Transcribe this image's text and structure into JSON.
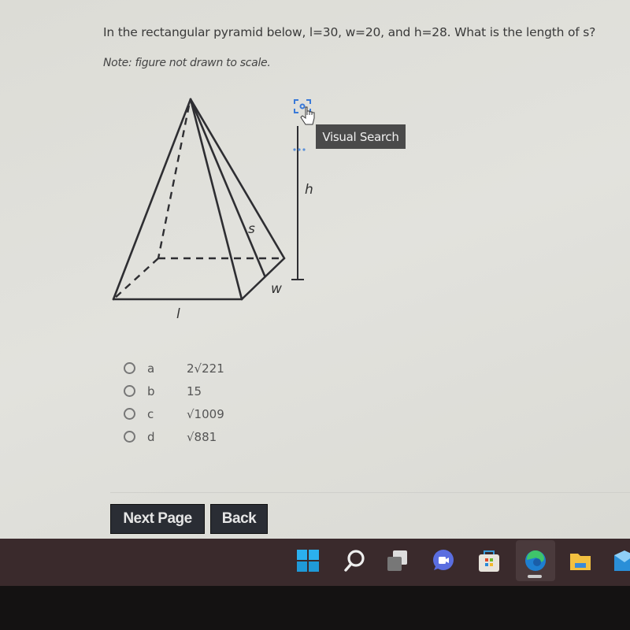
{
  "question": {
    "text": "In the rectangular pyramid below, l=30, w=20, and h=28. What is the length of s?",
    "note": "Note: figure not drawn to scale."
  },
  "figure": {
    "labels": {
      "s": "s",
      "h": "h",
      "w": "w",
      "l": "l"
    },
    "tooltip": "Visual Search"
  },
  "options": [
    {
      "letter": "a",
      "value": "2√221",
      "selected": false
    },
    {
      "letter": "b",
      "value": "15",
      "selected": false
    },
    {
      "letter": "c",
      "value": "√1009",
      "selected": false
    },
    {
      "letter": "d",
      "value": "√881",
      "selected": false
    }
  ],
  "buttons": {
    "next": "Next Page",
    "back": "Back"
  },
  "taskbar": {
    "icons": [
      "windows-start-icon",
      "search-icon",
      "task-view-icon",
      "teams-chat-icon",
      "store-icon",
      "edge-icon",
      "file-explorer-icon",
      "mail-icon"
    ],
    "colors": {
      "start": "#29a8e8",
      "edge": "#1e88d0",
      "folder": "#f2c040",
      "mail": "#2a8fd8"
    }
  }
}
